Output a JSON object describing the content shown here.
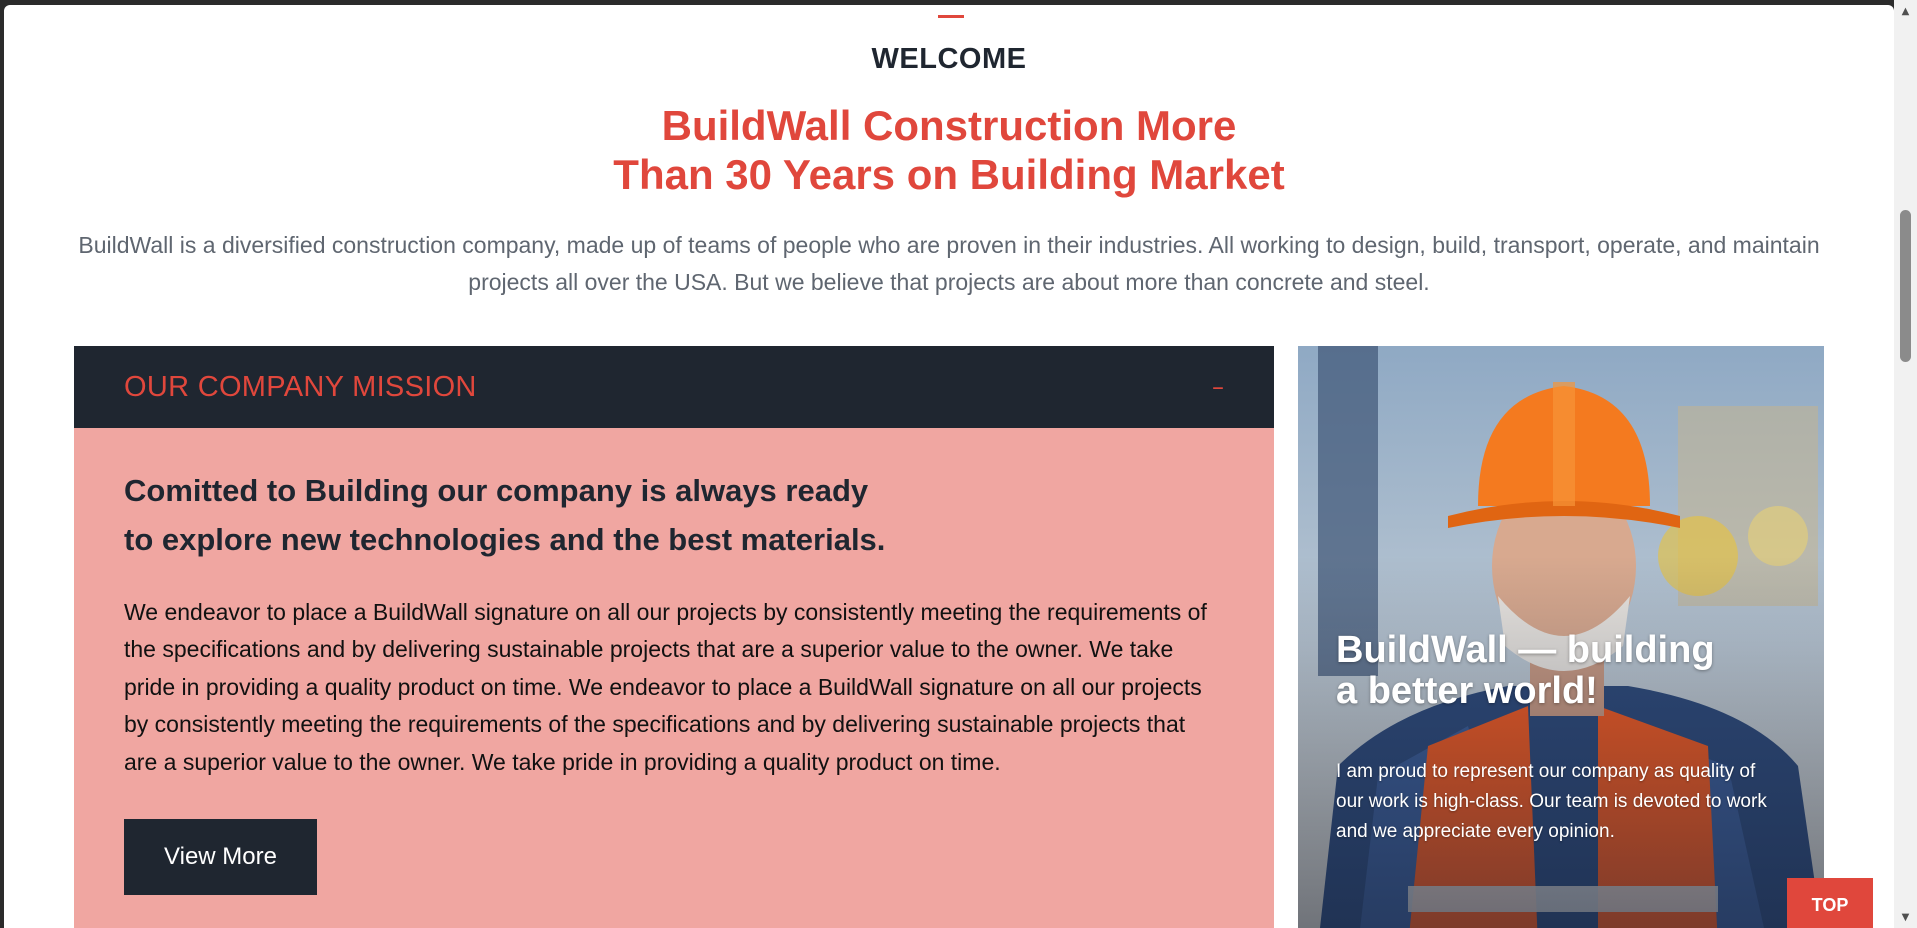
{
  "welcome": "WELCOME",
  "headline": {
    "line1": "BuildWall Construction More",
    "line2": "Than 30 Years on Building Market"
  },
  "intro": "BuildWall is a diversified construction company, made up of teams of people who are proven in their industries. All working to design, build, transport, operate, and maintain projects all over the USA. But we believe that projects are about more than concrete and steel.",
  "mission": {
    "title": "OUR COMPANY MISSION",
    "toggle": "–",
    "heading_line1": "Comitted to Building our company is always ready",
    "heading_line2": "to explore new technologies and the best materials.",
    "text": "We endeavor to place a BuildWall signature on all our projects by consistently meeting the requirements of the specifications and by delivering sustainable projects that are a superior value to the owner. We take pride in providing a quality product on time. We endeavor to place a BuildWall signature on all our projects by consistently meeting the requirements of the specifications and by delivering sustainable projects that are a superior value to the owner. We take pride in providing a quality product on time.",
    "button": "View More"
  },
  "promo": {
    "title_line1": "BuildWall — building",
    "title_line2": "a better world!",
    "text": "I am proud to represent our company as quality of our work is high-class. Our team is devoted to work and we appreciate every opinion."
  },
  "top_button": "TOP",
  "scrollbar": {
    "up_icon": "scroll-up-arrow-icon",
    "down_icon": "scroll-down-arrow-icon"
  },
  "colors": {
    "accent": "#e0473c",
    "dark": "#1f2630",
    "mission_bg": "#f0a6a1",
    "intro_text": "#5f6670"
  }
}
